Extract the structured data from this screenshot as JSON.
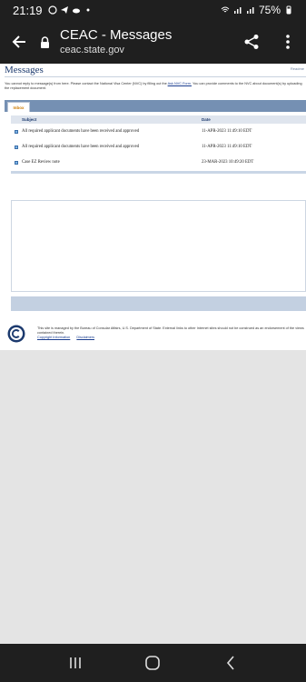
{
  "status_bar": {
    "time": "21:19",
    "battery": "75%"
  },
  "browser": {
    "title": "CEAC - Messages",
    "url": "ceac.state.gov"
  },
  "page": {
    "heading": "Messages",
    "readme": "Readme",
    "notice_before": "You cannot reply to message(s) from here. Please contact the National Visa Center (NVC) by filling out the ",
    "notice_link": "Ask NVC Form.",
    "notice_after": " You can provide comments to the NVC about document(s) by uploading the replacement document.",
    "tab_inbox": "Inbox",
    "columns": {
      "subject": "Subject",
      "date": "Date"
    },
    "messages": [
      {
        "subject": "All required applicant documents have been received and approved",
        "date": "11-APR-2023 11:49:10 EDT"
      },
      {
        "subject": "All required applicant documents have been received and approved",
        "date": "11-APR-2023 11:49:10 EDT"
      },
      {
        "subject": "Case EZ Review note",
        "date": "23-MAR-2023 10:49:20 EDT"
      }
    ]
  },
  "footer": {
    "text": "This site is managed by the Bureau of Consular Affairs, U.S. Department of State. External links to other Internet sites should not be construed as an endorsement of the views contained therein.",
    "copyright": "Copyright Information",
    "disclaimers": "Disclaimers"
  },
  "icons": [
    "back-arrow-icon",
    "lock-icon",
    "share-icon",
    "more-vert-icon",
    "recents-icon",
    "home-icon",
    "back-nav-icon"
  ]
}
